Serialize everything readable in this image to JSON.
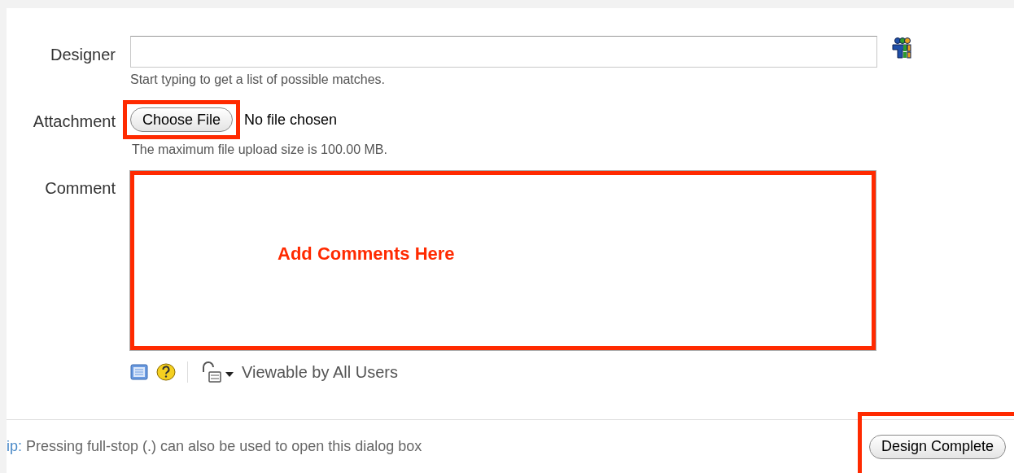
{
  "designer": {
    "label": "Designer",
    "hint": "Start typing to get a list of possible matches."
  },
  "attachment": {
    "label": "Attachment",
    "button": "Choose File",
    "status": "No file chosen",
    "hint": "The maximum file upload size is 100.00 MB.",
    "highlighted": true
  },
  "comment": {
    "label": "Comment",
    "annotation": "Add Comments Here",
    "highlighted": true,
    "visibility": "Viewable by All Users"
  },
  "footer": {
    "tip_prefix": "ip:",
    "tip": "Pressing full-stop (.) can also be used to open this dialog box",
    "submit": "Design Complete",
    "submit_highlighted": true
  }
}
